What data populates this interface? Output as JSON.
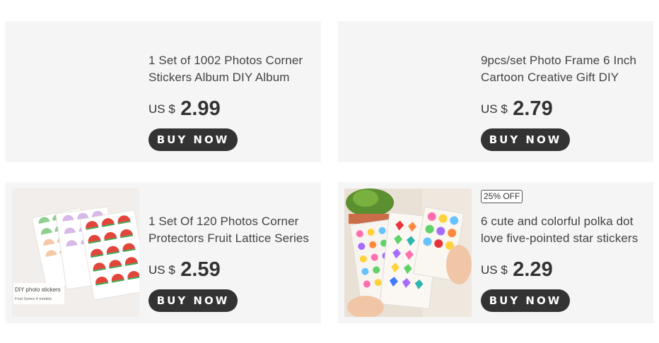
{
  "products": [
    {
      "title": "1 Set of 1002 Photos Corner Stickers Album DIY Album",
      "currency": "US $",
      "price": "2.99",
      "buy_label": "BUY NOW",
      "badge": ""
    },
    {
      "title": "9pcs/set Photo Frame 6 Inch Cartoon Creative Gift DIY",
      "currency": "US $",
      "price": "2.79",
      "buy_label": "BUY NOW",
      "badge": ""
    },
    {
      "title": "1 Set Of 120 Photos Corner Protectors Fruit Lattice Series",
      "currency": "US $",
      "price": "2.59",
      "buy_label": "BUY NOW",
      "badge": "",
      "image_text": {
        "line1": "DIY photo stickers",
        "line2": "Fruit Series 4 models"
      }
    },
    {
      "title": "6 cute and colorful polka dot love five-pointed star stickers",
      "currency": "US $",
      "price": "2.29",
      "buy_label": "BUY NOW",
      "badge": "25% OFF"
    }
  ],
  "colors": {
    "card_bg": "#f5f5f5",
    "button_bg": "#333333",
    "button_text": "#ffffff"
  }
}
